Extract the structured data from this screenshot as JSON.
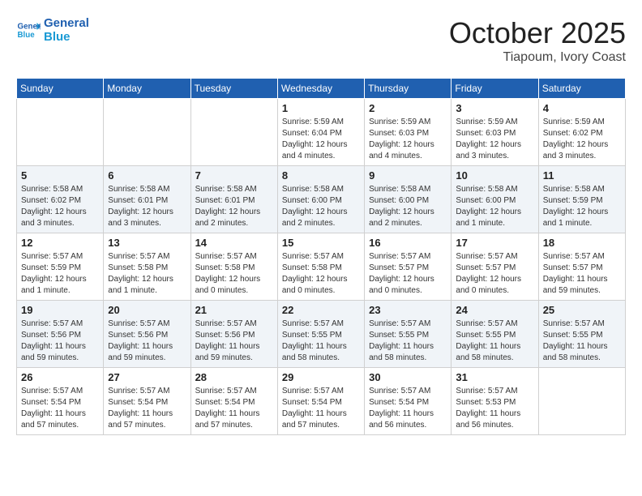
{
  "header": {
    "logo_line1": "General",
    "logo_line2": "Blue",
    "month": "October 2025",
    "location": "Tiapoum, Ivory Coast"
  },
  "weekdays": [
    "Sunday",
    "Monday",
    "Tuesday",
    "Wednesday",
    "Thursday",
    "Friday",
    "Saturday"
  ],
  "weeks": [
    [
      {
        "day": "",
        "info": ""
      },
      {
        "day": "",
        "info": ""
      },
      {
        "day": "",
        "info": ""
      },
      {
        "day": "1",
        "info": "Sunrise: 5:59 AM\nSunset: 6:04 PM\nDaylight: 12 hours\nand 4 minutes."
      },
      {
        "day": "2",
        "info": "Sunrise: 5:59 AM\nSunset: 6:03 PM\nDaylight: 12 hours\nand 4 minutes."
      },
      {
        "day": "3",
        "info": "Sunrise: 5:59 AM\nSunset: 6:03 PM\nDaylight: 12 hours\nand 3 minutes."
      },
      {
        "day": "4",
        "info": "Sunrise: 5:59 AM\nSunset: 6:02 PM\nDaylight: 12 hours\nand 3 minutes."
      }
    ],
    [
      {
        "day": "5",
        "info": "Sunrise: 5:58 AM\nSunset: 6:02 PM\nDaylight: 12 hours\nand 3 minutes."
      },
      {
        "day": "6",
        "info": "Sunrise: 5:58 AM\nSunset: 6:01 PM\nDaylight: 12 hours\nand 3 minutes."
      },
      {
        "day": "7",
        "info": "Sunrise: 5:58 AM\nSunset: 6:01 PM\nDaylight: 12 hours\nand 2 minutes."
      },
      {
        "day": "8",
        "info": "Sunrise: 5:58 AM\nSunset: 6:00 PM\nDaylight: 12 hours\nand 2 minutes."
      },
      {
        "day": "9",
        "info": "Sunrise: 5:58 AM\nSunset: 6:00 PM\nDaylight: 12 hours\nand 2 minutes."
      },
      {
        "day": "10",
        "info": "Sunrise: 5:58 AM\nSunset: 6:00 PM\nDaylight: 12 hours\nand 1 minute."
      },
      {
        "day": "11",
        "info": "Sunrise: 5:58 AM\nSunset: 5:59 PM\nDaylight: 12 hours\nand 1 minute."
      }
    ],
    [
      {
        "day": "12",
        "info": "Sunrise: 5:57 AM\nSunset: 5:59 PM\nDaylight: 12 hours\nand 1 minute."
      },
      {
        "day": "13",
        "info": "Sunrise: 5:57 AM\nSunset: 5:58 PM\nDaylight: 12 hours\nand 1 minute."
      },
      {
        "day": "14",
        "info": "Sunrise: 5:57 AM\nSunset: 5:58 PM\nDaylight: 12 hours\nand 0 minutes."
      },
      {
        "day": "15",
        "info": "Sunrise: 5:57 AM\nSunset: 5:58 PM\nDaylight: 12 hours\nand 0 minutes."
      },
      {
        "day": "16",
        "info": "Sunrise: 5:57 AM\nSunset: 5:57 PM\nDaylight: 12 hours\nand 0 minutes."
      },
      {
        "day": "17",
        "info": "Sunrise: 5:57 AM\nSunset: 5:57 PM\nDaylight: 12 hours\nand 0 minutes."
      },
      {
        "day": "18",
        "info": "Sunrise: 5:57 AM\nSunset: 5:57 PM\nDaylight: 11 hours\nand 59 minutes."
      }
    ],
    [
      {
        "day": "19",
        "info": "Sunrise: 5:57 AM\nSunset: 5:56 PM\nDaylight: 11 hours\nand 59 minutes."
      },
      {
        "day": "20",
        "info": "Sunrise: 5:57 AM\nSunset: 5:56 PM\nDaylight: 11 hours\nand 59 minutes."
      },
      {
        "day": "21",
        "info": "Sunrise: 5:57 AM\nSunset: 5:56 PM\nDaylight: 11 hours\nand 59 minutes."
      },
      {
        "day": "22",
        "info": "Sunrise: 5:57 AM\nSunset: 5:55 PM\nDaylight: 11 hours\nand 58 minutes."
      },
      {
        "day": "23",
        "info": "Sunrise: 5:57 AM\nSunset: 5:55 PM\nDaylight: 11 hours\nand 58 minutes."
      },
      {
        "day": "24",
        "info": "Sunrise: 5:57 AM\nSunset: 5:55 PM\nDaylight: 11 hours\nand 58 minutes."
      },
      {
        "day": "25",
        "info": "Sunrise: 5:57 AM\nSunset: 5:55 PM\nDaylight: 11 hours\nand 58 minutes."
      }
    ],
    [
      {
        "day": "26",
        "info": "Sunrise: 5:57 AM\nSunset: 5:54 PM\nDaylight: 11 hours\nand 57 minutes."
      },
      {
        "day": "27",
        "info": "Sunrise: 5:57 AM\nSunset: 5:54 PM\nDaylight: 11 hours\nand 57 minutes."
      },
      {
        "day": "28",
        "info": "Sunrise: 5:57 AM\nSunset: 5:54 PM\nDaylight: 11 hours\nand 57 minutes."
      },
      {
        "day": "29",
        "info": "Sunrise: 5:57 AM\nSunset: 5:54 PM\nDaylight: 11 hours\nand 57 minutes."
      },
      {
        "day": "30",
        "info": "Sunrise: 5:57 AM\nSunset: 5:54 PM\nDaylight: 11 hours\nand 56 minutes."
      },
      {
        "day": "31",
        "info": "Sunrise: 5:57 AM\nSunset: 5:53 PM\nDaylight: 11 hours\nand 56 minutes."
      },
      {
        "day": "",
        "info": ""
      }
    ]
  ]
}
